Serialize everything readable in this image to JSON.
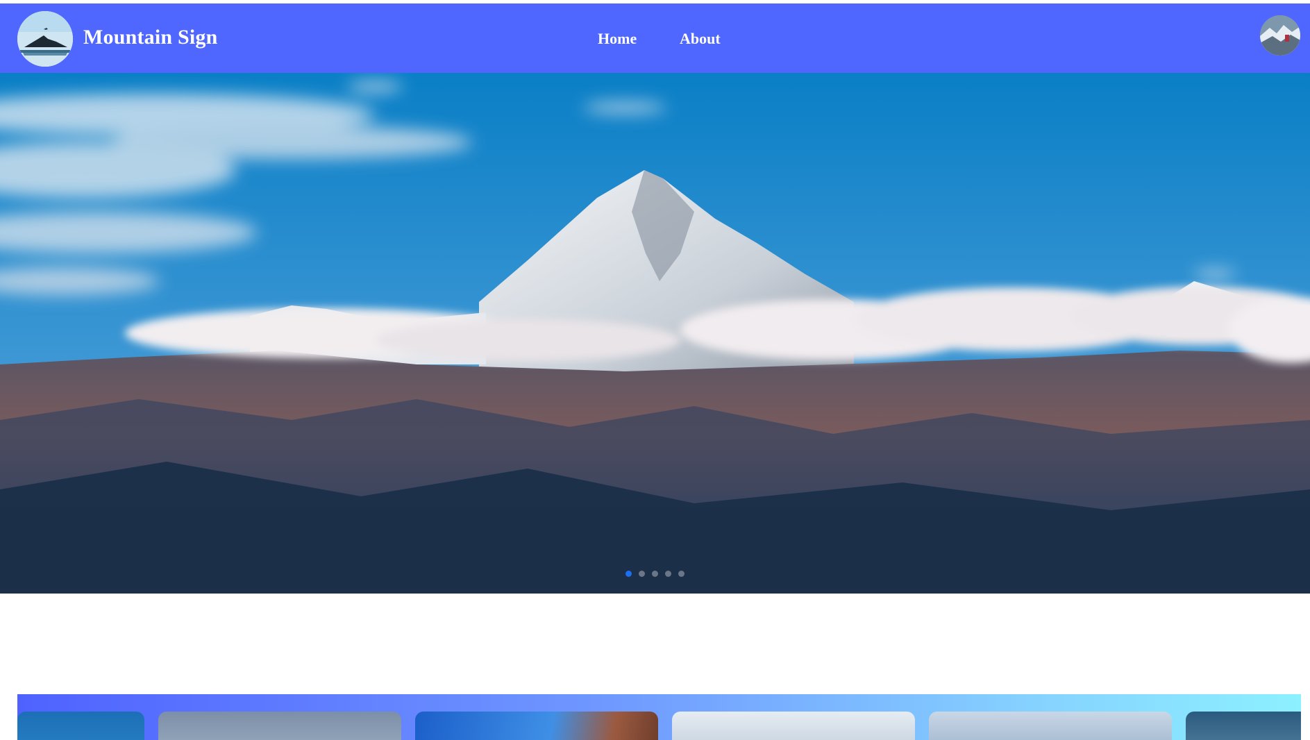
{
  "header": {
    "brand": "Mountain Sign",
    "nav": [
      {
        "label": "Home"
      },
      {
        "label": "About"
      }
    ]
  },
  "colors": {
    "navbar": "#4f67ff",
    "active_dot": "#1e6ff0",
    "gallery_gradient_start": "#4f62ff",
    "gallery_gradient_end": "#8cf0ff"
  },
  "icons": {
    "logo": "mountain-logo-icon",
    "avatar": "user-avatar"
  },
  "hero": {
    "slide_count": 5,
    "active_slide": 1
  },
  "gallery": {
    "visible_cards": 6
  }
}
